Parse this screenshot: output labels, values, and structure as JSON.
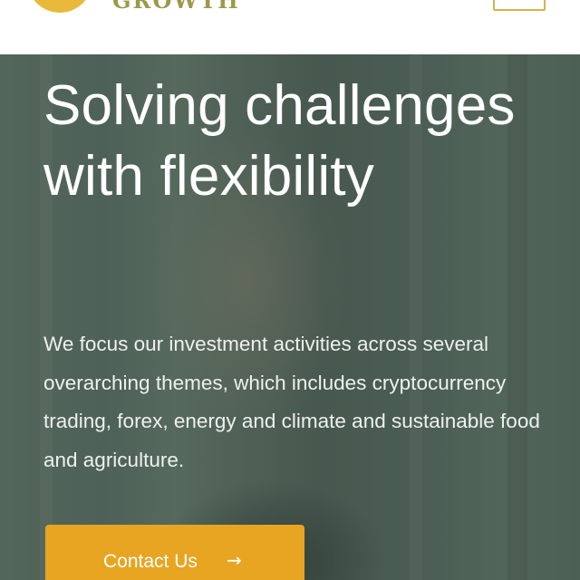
{
  "header": {
    "brand_text": "GROWTH",
    "logo_icon": "logo-coin-icon",
    "menu_icon": "menu-icon",
    "accent_color": "#e8b93a"
  },
  "hero": {
    "title": "Solving challenges with flexibility",
    "description": "We focus our investment activities across several overarching themes, which includes cryptocurrency trading, forex, energy and climate and sustainable food and agriculture.",
    "cta_label": "Contact Us",
    "cta_arrow": "→",
    "cta_color": "#e7a521",
    "overlay_color": "#4b5f55"
  }
}
